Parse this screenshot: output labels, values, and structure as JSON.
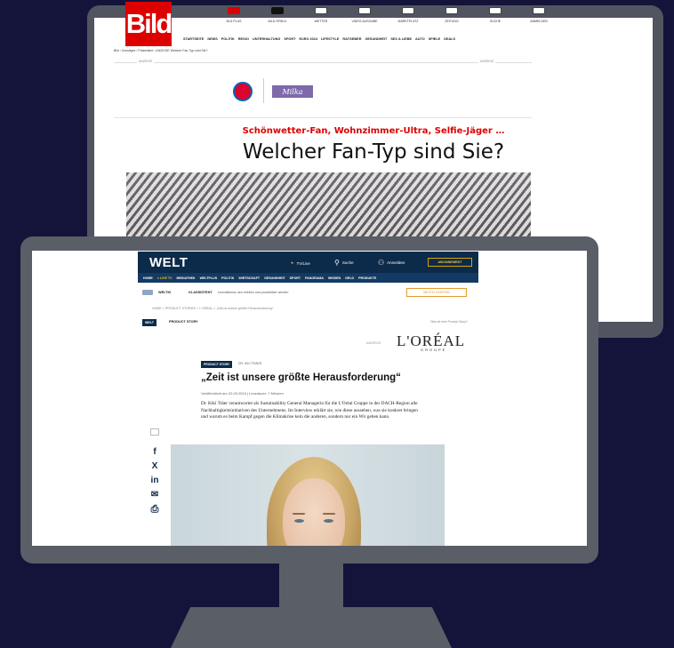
{
  "bild": {
    "logo": "Bild",
    "top_icons": [
      {
        "label": "BLD PLUS",
        "style": "red",
        "icon": "plus-badge-icon"
      },
      {
        "label": "BILD SPIELE",
        "style": "black",
        "icon": "game-badge-icon"
      },
      {
        "label": "WETTER",
        "style": "outline",
        "icon": "weather-icon"
      },
      {
        "label": "VIDEO-AUSGABE",
        "style": "outline",
        "icon": "video-icon"
      },
      {
        "label": "MARKTPLATZ",
        "style": "outline",
        "icon": "store-icon"
      },
      {
        "label": "ZEITUNG",
        "style": "outline",
        "icon": "newspaper-icon"
      },
      {
        "label": "SUCHE",
        "style": "outline",
        "icon": "search-icon"
      },
      {
        "label": "ANMELDEN",
        "style": "outline",
        "icon": "user-icon"
      }
    ],
    "nav": [
      "STARTSEITE",
      "NEWS",
      "POLITIK",
      "REGIO",
      "UNTERHALTUNG",
      "SPORT",
      "EURO 2024",
      "LIFESTYLE",
      "RATGEBER",
      "GESUNDHEIT",
      "SEX & LIEBE",
      "AUTO",
      "SPIELE",
      "DEALS"
    ],
    "breadcrumb": "Bild › Sonstiges › Präsentiert › ANZEIGE Welcher Fan-Typ sind Sie?",
    "anzeige_left": "ANZEIGE",
    "anzeige_right": "ANZEIGE",
    "sponsor": "Milka",
    "kicker": "Schönwetter-Fan, Wohnzimmer-Ultra, Selfie-Jäger …",
    "headline": "Welcher Fan-Typ sind Sie?"
  },
  "welt": {
    "logo": "WELT",
    "header": {
      "tv": "TV/Live",
      "search": "Suche",
      "login": "Anmelden",
      "subscribe": "ABONNEMENT"
    },
    "nav": [
      "HOME",
      "● LIVE TV",
      "MEDIATHEK",
      "WELTPLUS",
      "POLITIK",
      "WIRTSCHAFT",
      "GESUNDHEIT",
      "SPORT",
      "PANORAMA",
      "WISSEN",
      "GELD",
      "PRODUKTE"
    ],
    "ki_bar": {
      "label": "WELTKI",
      "assistant": "KI-ASSISTENT",
      "text": "Journalismus neu erleben und produktiver werden",
      "button": "WELTKI STARTEN"
    },
    "breadcrumb": "HOME > PRODUCT STORIES > L'ORÉAL > „Zeit ist unsere größte Herausforderung“",
    "product_story_badge": "WELT",
    "product_story_label": "PRODUCT STORY",
    "product_story_right": "Was ist eine Product Story?",
    "sponsor_anzeige": "ANZEIGE",
    "sponsor": "L'ORÉAL",
    "sponsor_sub": "GROUPE",
    "article": {
      "tag": "PRODUCT STORY",
      "author": "DR. KIKI TRÄER",
      "title": "„Zeit ist unsere größte Herausforderung“",
      "meta": "Veröffentlicht am 22.05.2024 | Lesedauer: 7 Minuten",
      "body": "Dr. Kiki Träer verantwortet als Sustainability General Managerin für die L'Oréal Gruppe in der DACH-Region alle Nachhaltigkeitsinitiativen des Unternehmens. Im Interview erklärt sie, wie diese aussehen, was sie konkret bringen und warum es beim Kampf gegen die Klimakrise kein die anderen, sondern nur ein Wir geben kann."
    },
    "share_icons": [
      {
        "glyph": "f",
        "name": "facebook-icon"
      },
      {
        "glyph": "X",
        "name": "x-icon"
      },
      {
        "glyph": "in",
        "name": "linkedin-icon"
      },
      {
        "glyph": "✉",
        "name": "mail-icon"
      },
      {
        "glyph": "⎙",
        "name": "print-icon"
      }
    ]
  },
  "colors": {
    "background": "#14133a",
    "bild_red": "#dd0000",
    "welt_navy": "#0c2a4a",
    "monitor_frame": "#5a5e67"
  }
}
